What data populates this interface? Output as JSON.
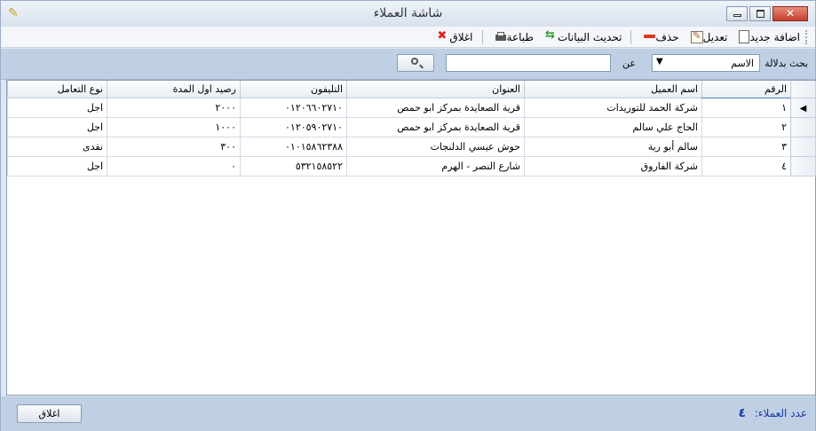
{
  "window": {
    "title": "شاشة العملاء"
  },
  "toolbar": {
    "add_label": "اضافة جديد",
    "edit_label": "تعديل",
    "delete_label": "حذف",
    "refresh_label": "تحديث البيانات",
    "print_label": "طباعة",
    "close_label": "اغلاق"
  },
  "search": {
    "search_by_label": "بحث بدلالة",
    "field_selected": "الاسم",
    "about_label": "عن",
    "query_value": ""
  },
  "table": {
    "columns": [
      "الرقم",
      "اسم العميل",
      "العنوان",
      "التليفون",
      "رصيد اول المدة",
      "نوع التعامل"
    ],
    "rows": [
      [
        "١",
        "شركة الحمد للتوريدات",
        "قرية الصعايدة بمركز ابو حمص",
        "٠١٢٠٦٦٠٢٧١٠",
        "٢٠٠٠",
        "اجل"
      ],
      [
        "٢",
        "الحاج علي سالم",
        "قرية الصعايدة بمركز ابو حمص",
        "٠١٢٠٥٩٠٢٧١٠",
        "١٠٠٠",
        "اجل"
      ],
      [
        "٣",
        "سالم أبو رية",
        "حوش عيسي الدلنجات",
        "٠١٠١٥٨٦٢٣٨٨",
        "٣٠٠",
        "نقدى"
      ],
      [
        "٤",
        "شركة الفاروق",
        "شارع النصر - الهرم",
        "٥٣٢١٥٨٥٢٢",
        "٠",
        "اجل"
      ]
    ]
  },
  "footer": {
    "close_button": "اغلاق",
    "count_label": "عدد العملاء:",
    "count_value": "٤"
  }
}
